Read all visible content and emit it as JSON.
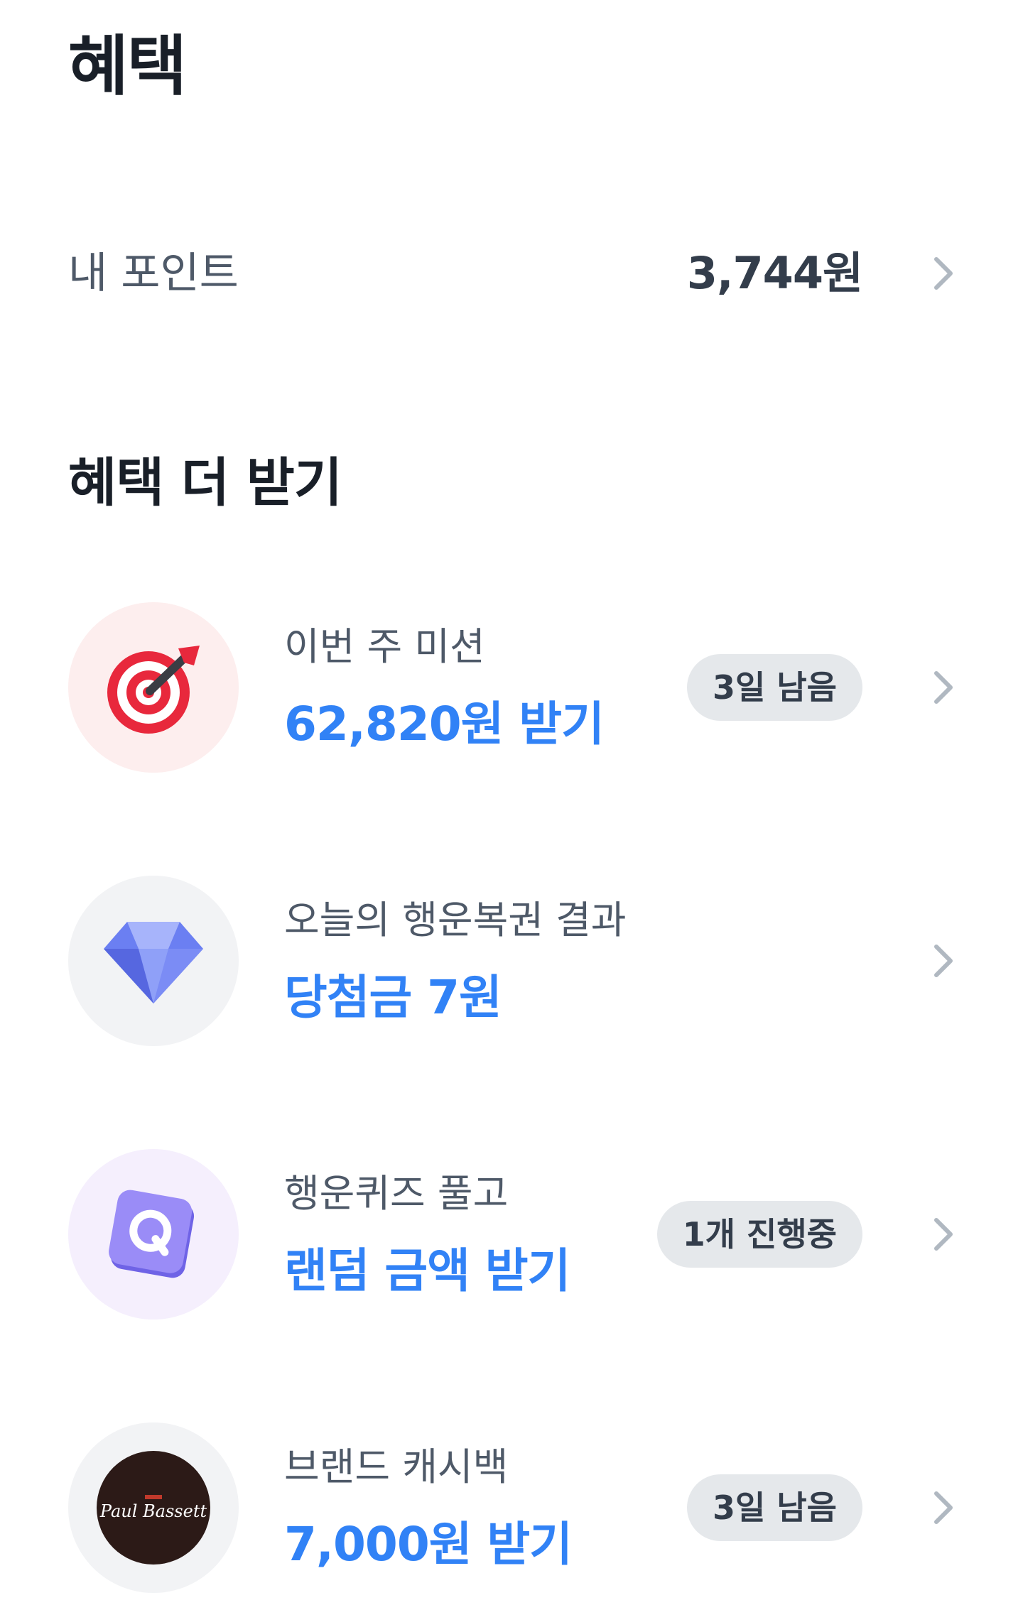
{
  "page": {
    "title": "혜택"
  },
  "points": {
    "label": "내 포인트",
    "value": "3,744원"
  },
  "section": {
    "title": "혜택 더 받기"
  },
  "items": [
    {
      "subtitle": "이번 주 미션",
      "main": "62,820원 받기",
      "badge": "3일 남음",
      "icon": "target-dart-icon",
      "icon_bg": "#fdeeee"
    },
    {
      "subtitle": "오늘의 행운복권 결과",
      "main": "당첨금 7원",
      "badge": "",
      "icon": "diamond-icon",
      "icon_bg": "#f2f3f5"
    },
    {
      "subtitle": "행운퀴즈 풀고",
      "main": "랜덤 금액 받기",
      "badge": "1개 진행중",
      "icon": "quiz-q-icon",
      "icon_bg": "#f5effd"
    },
    {
      "subtitle": "브랜드 캐시백",
      "main": "7,000원 받기",
      "badge": "3일 남음",
      "icon": "brand-logo-icon",
      "icon_bg": "#f2f3f5",
      "logo_text": "Paul Bassett"
    }
  ],
  "colors": {
    "accent": "#3182f6",
    "title": "#191f28",
    "subtext": "#4e5968",
    "badge_bg": "#e5e8eb",
    "chevron": "#b0b8c1"
  }
}
